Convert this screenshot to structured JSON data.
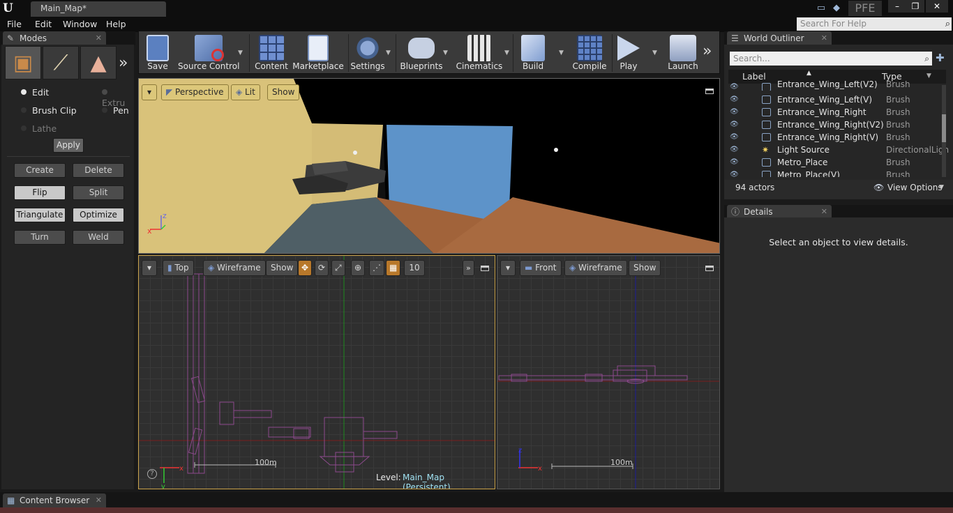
{
  "titlebar": {
    "doc_tab": "Main_Map*",
    "pfe": "PFE",
    "help_search_placeholder": "Search For Help"
  },
  "menu": [
    "File",
    "Edit",
    "Window",
    "Help"
  ],
  "modes": {
    "tab": "Modes",
    "options": [
      {
        "label": "Edit",
        "active": true
      },
      {
        "label": "Extru",
        "active": false
      },
      {
        "label": "Brush Clip",
        "active": false
      },
      {
        "label": "Pen",
        "active": false
      },
      {
        "label": "Lathe",
        "active": false
      }
    ],
    "apply": "Apply",
    "buttons": [
      "Create",
      "Delete",
      "Flip",
      "Split",
      "Triangulate",
      "Optimize",
      "Turn",
      "Weld"
    ]
  },
  "toolbar": [
    "Save",
    "Source Control",
    "Content",
    "Marketplace",
    "Settings",
    "Blueprints",
    "Cinematics",
    "Build",
    "Compile",
    "Play",
    "Launch"
  ],
  "viewport_perspective": {
    "view": "Perspective",
    "lit": "Lit",
    "show": "Show"
  },
  "viewport_top": {
    "view": "Top",
    "mode": "Wireframe",
    "show": "Show",
    "grid": "10",
    "scale": "100m",
    "level_label": "Level:",
    "level_name": "Main_Map (Persistent)"
  },
  "viewport_front": {
    "view": "Front",
    "mode": "Wireframe",
    "show": "Show",
    "scale": "100m"
  },
  "outliner": {
    "tab": "World Outliner",
    "search_placeholder": "Search...",
    "col_label": "Label",
    "col_type": "Type",
    "rows": [
      {
        "label": "Entrance_Wing_Left(V2)",
        "type": "Brush"
      },
      {
        "label": "Entrance_Wing_Left(V)",
        "type": "Brush"
      },
      {
        "label": "Entrance_Wing_Right",
        "type": "Brush"
      },
      {
        "label": "Entrance_Wing_Right(V2)",
        "type": "Brush"
      },
      {
        "label": "Entrance_Wing_Right(V)",
        "type": "Brush"
      },
      {
        "label": "Light Source",
        "type": "DirectionalLigh"
      },
      {
        "label": "Metro_Place",
        "type": "Brush"
      },
      {
        "label": "Metro_Place(V)",
        "type": "Brush"
      }
    ],
    "count": "94 actors",
    "view_options": "View Options"
  },
  "details": {
    "tab": "Details",
    "empty_message": "Select an object to view details."
  },
  "content_browser": {
    "tab": "Content Browser"
  },
  "colors": {
    "accent": "#c9a24a",
    "panel": "#262626",
    "toolbar": "#3a3a3a"
  }
}
